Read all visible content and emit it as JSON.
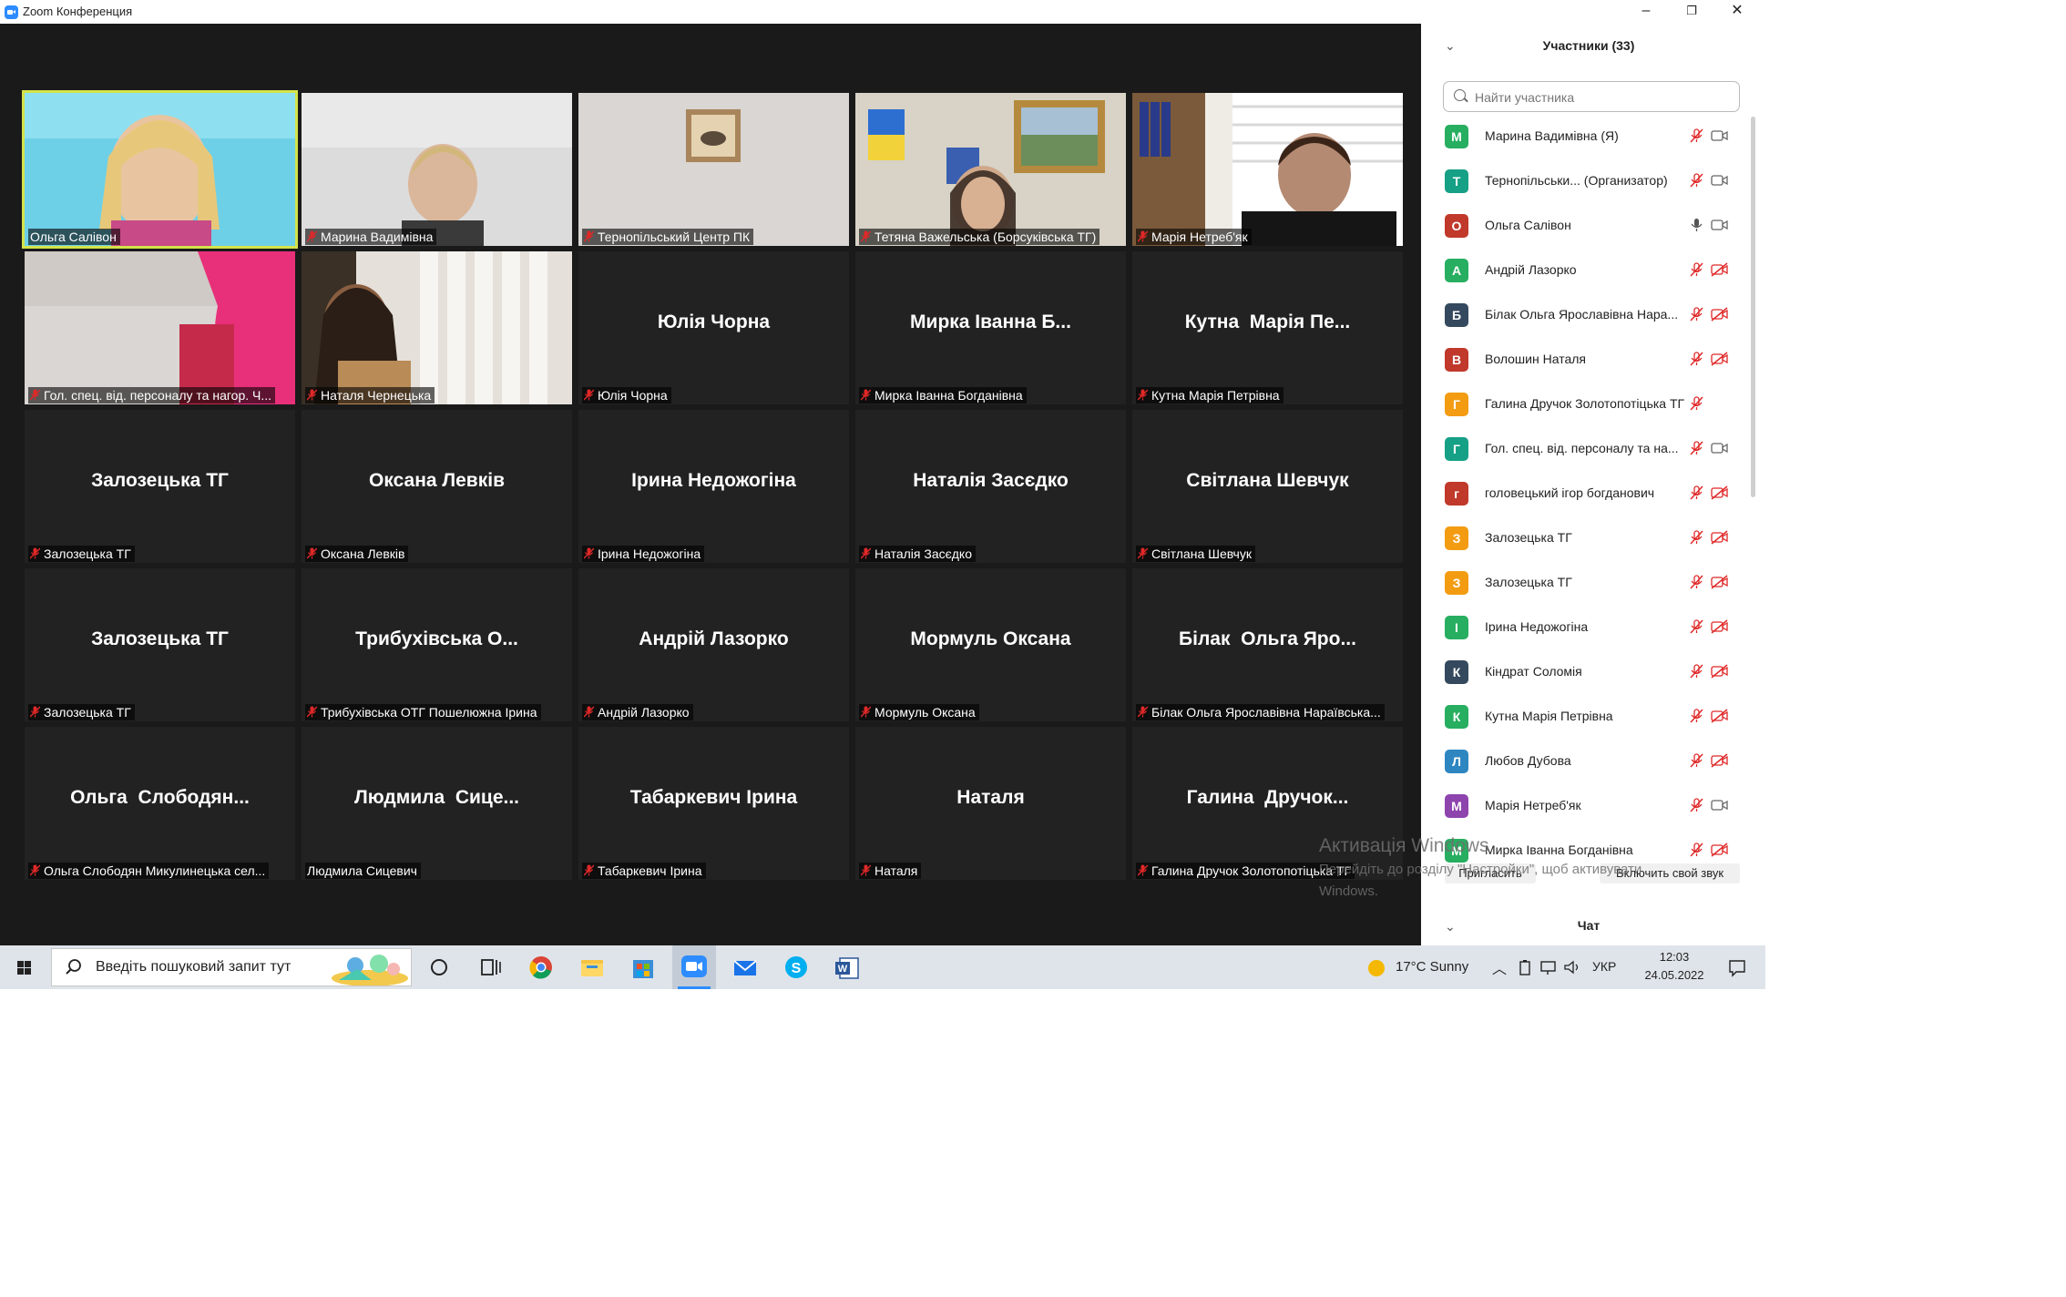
{
  "window": {
    "title": "Zoom Конференция"
  },
  "tiles": [
    {
      "label": "Ольга Салівон",
      "muted": false,
      "kind": "video",
      "active": true
    },
    {
      "label": "Марина Вадимівна",
      "muted": true,
      "kind": "video"
    },
    {
      "label": "Тернопільський Центр ПК",
      "muted": true,
      "kind": "video"
    },
    {
      "label": "Тетяна Важельська (Борсуківська ТГ)",
      "muted": true,
      "kind": "video"
    },
    {
      "label": "Марія Нетреб'як",
      "muted": true,
      "kind": "video"
    },
    {
      "label": "Гол. спец. від. персоналу та нагор. Ч...",
      "muted": true,
      "kind": "video"
    },
    {
      "label": "Наталя Чернецька",
      "muted": true,
      "kind": "video"
    },
    {
      "big": "Юлія Чорна",
      "label": "Юлія Чорна",
      "muted": true
    },
    {
      "big": "Мирка Іванна Б...",
      "label": "Мирка Іванна Богданівна",
      "muted": true
    },
    {
      "big": "Кутна  Марія Пе...",
      "label": "Кутна Марія Петрівна",
      "muted": true
    },
    {
      "big": "Залозецька ТГ",
      "label": "Залозецька ТГ",
      "muted": true
    },
    {
      "big": "Оксана Левків",
      "label": "Оксана Левків",
      "muted": true
    },
    {
      "big": "Ірина Недожогіна",
      "label": "Ірина Недожогіна",
      "muted": true
    },
    {
      "big": "Наталія Засєдко",
      "label": "Наталія Засєдко",
      "muted": true
    },
    {
      "big": "Світлана Шевчук",
      "label": "Світлана Шевчук",
      "muted": true
    },
    {
      "big": "Залозецька ТГ",
      "label": "Залозецька ТГ",
      "muted": true
    },
    {
      "big": "Трибухівська О...",
      "label": "Трибухівська ОТГ Пошелюжна Ірина",
      "muted": true
    },
    {
      "big": "Андрій Лазорко",
      "label": "Андрій Лазорко",
      "muted": true
    },
    {
      "big": "Мормуль Оксана",
      "label": "Мормуль Оксана",
      "muted": true
    },
    {
      "big": "Білак  Ольга Яро...",
      "label": "Білак Ольга Ярославівна Нараївська...",
      "muted": true
    },
    {
      "big": "Ольга  Слободян...",
      "label": "Ольга Слободян Микулинецька сел...",
      "muted": true
    },
    {
      "big": "Людмила  Сице...",
      "label": "Людмила Сицевич",
      "muted": false
    },
    {
      "big": "Табаркевич Ірина",
      "label": "Табаркевич Ірина",
      "muted": true
    },
    {
      "big": "Наталя",
      "label": "Наталя",
      "muted": true
    },
    {
      "big": "Галина  Дручок...",
      "label": "Галина Дручок Золотопотіцька ТГ",
      "muted": true
    }
  ],
  "panel": {
    "title": "Участники (33)",
    "search_placeholder": "Найти участника",
    "participants": [
      {
        "initial": "М",
        "color": "#27ae60",
        "name": "Марина Вадимівна (Я)",
        "mic": "muted",
        "video": "on"
      },
      {
        "initial": "Т",
        "color": "#16a085",
        "name": "Тернопільськи...  (Организатор)",
        "mic": "muted",
        "video": "on"
      },
      {
        "initial": "О",
        "color": "#c0392b",
        "name": "Ольга Салівон",
        "mic": "on",
        "video": "on"
      },
      {
        "initial": "А",
        "color": "#27ae60",
        "name": "Андрій Лазорко",
        "mic": "muted",
        "video": "off"
      },
      {
        "initial": "Б",
        "color": "#34495e",
        "name": "Білак Ольга Ярославівна Нара...",
        "mic": "muted",
        "video": "off"
      },
      {
        "initial": "В",
        "color": "#c0392b",
        "name": "Волошин Наталя",
        "mic": "muted",
        "video": "off"
      },
      {
        "initial": "Г",
        "color": "#f39c12",
        "name": "Галина Дручок Золотопотіцька ТГ",
        "mic": "muted",
        "video": "none"
      },
      {
        "initial": "Г",
        "color": "#16a085",
        "name": "Гол. спец. від. персоналу та на...",
        "mic": "muted",
        "video": "on"
      },
      {
        "initial": "г",
        "color": "#c0392b",
        "name": "головецький ігор богданович",
        "mic": "muted",
        "video": "off"
      },
      {
        "initial": "З",
        "color": "#f39c12",
        "name": "Залозецька ТГ",
        "mic": "muted",
        "video": "off"
      },
      {
        "initial": "З",
        "color": "#f39c12",
        "name": "Залозецька ТГ",
        "mic": "muted",
        "video": "off"
      },
      {
        "initial": "І",
        "color": "#27ae60",
        "name": "Ірина Недожогіна",
        "mic": "muted",
        "video": "off"
      },
      {
        "initial": "К",
        "color": "#34495e",
        "name": "Кіндрат Соломія",
        "mic": "muted",
        "video": "off"
      },
      {
        "initial": "К",
        "color": "#27ae60",
        "name": "Кутна Марія Петрівна",
        "mic": "muted",
        "video": "off"
      },
      {
        "initial": "Л",
        "color": "#2e86c1",
        "name": "Любов Дубова",
        "mic": "muted",
        "video": "off"
      },
      {
        "initial": "М",
        "color": "#8e44ad",
        "name": "Марія Нетреб'як",
        "mic": "muted",
        "video": "on"
      },
      {
        "initial": "М",
        "color": "#27ae60",
        "name": "Мирка Іванна Богданівна",
        "mic": "muted",
        "video": "off"
      }
    ],
    "invite_label": "Пригласить",
    "unmute_label": "Включить свой звук",
    "chat_label": "Чат"
  },
  "activation": {
    "line1": "Активація Windows",
    "line2": "Перейдіть до розділу \"Настройки\", щоб активувати",
    "line3": "Windows."
  },
  "taskbar": {
    "search_text": "Введіть пошуковий запит тут",
    "weather": "17°C  Sunny",
    "lang": "УКР",
    "time": "12:03",
    "date": "24.05.2022"
  },
  "colors": {
    "active_speaker": "#d4e34a",
    "muted_icon": "#e02828",
    "zoom_blue": "#2d8cff"
  }
}
